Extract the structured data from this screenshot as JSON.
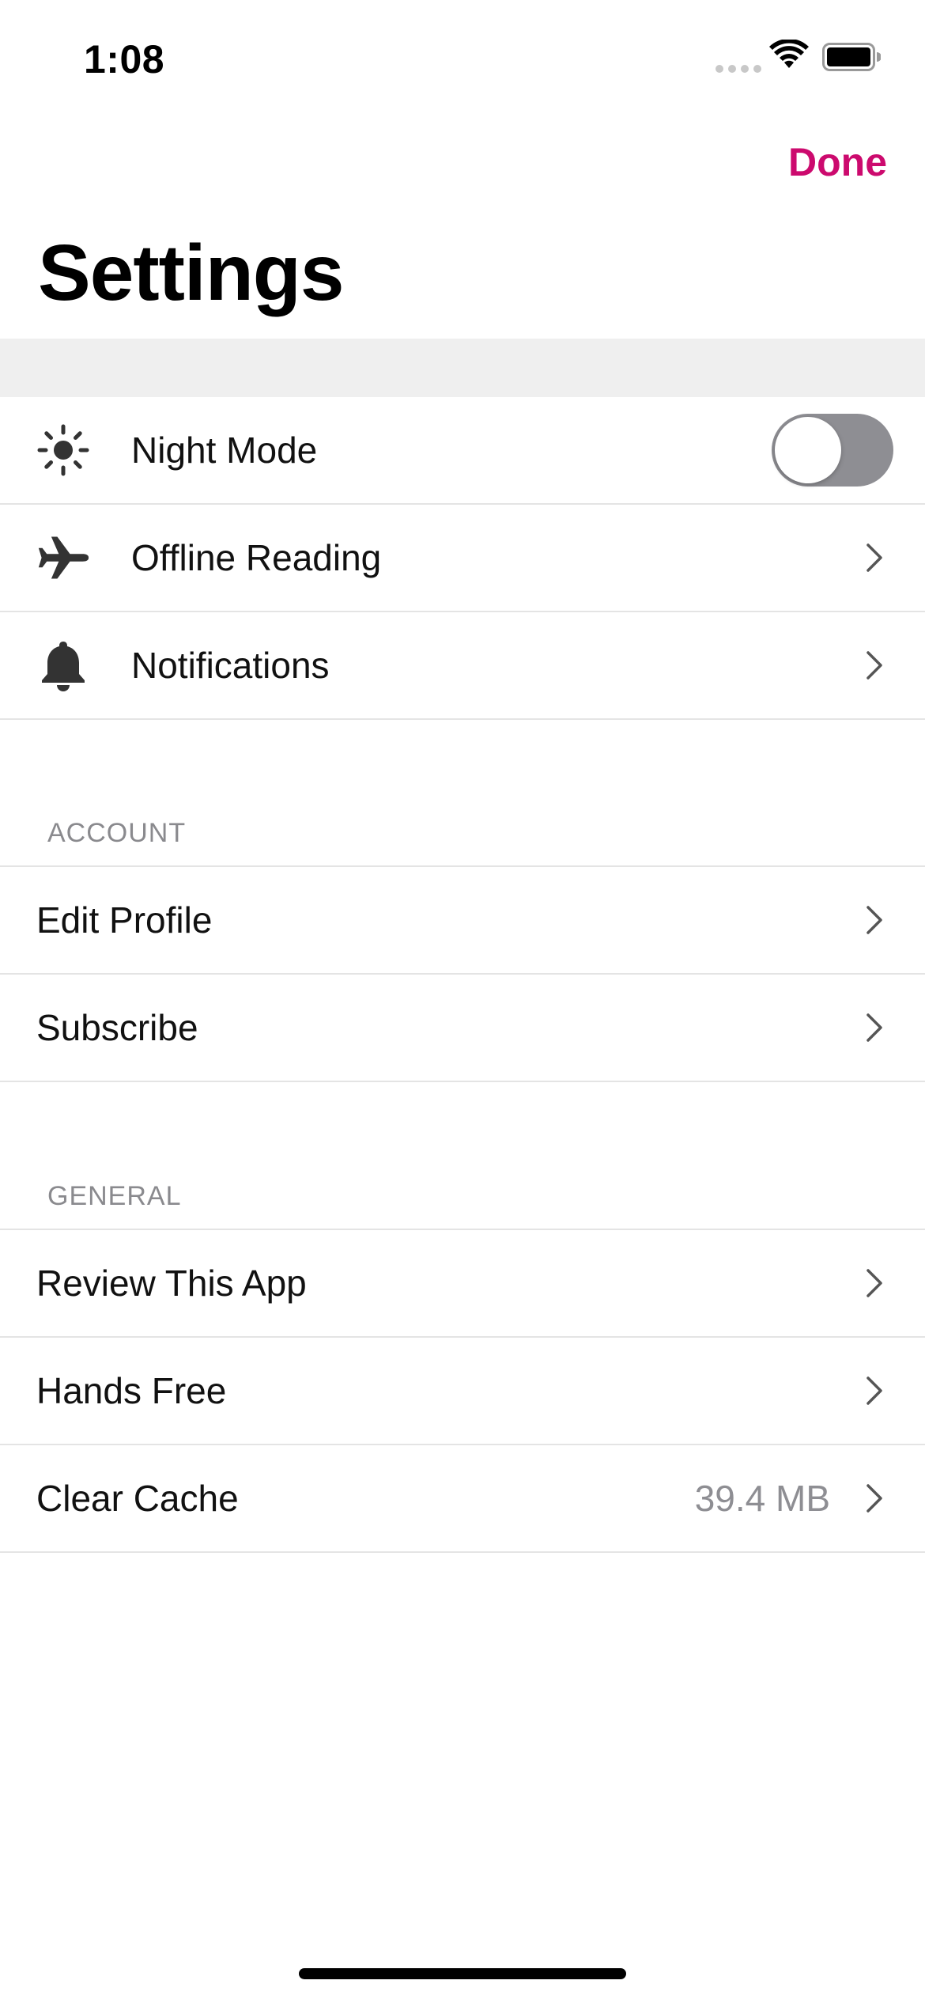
{
  "status_bar": {
    "time": "1:08",
    "icons": [
      "cellular-signal-icon",
      "wifi-icon",
      "battery-icon"
    ]
  },
  "nav": {
    "done_label": "Done",
    "title": "Settings"
  },
  "colors": {
    "accent": "#cc0a6e",
    "section_header": "#8a8a8e",
    "toggle_off": "#8e8e93",
    "band": "#efefef"
  },
  "top_section": {
    "items": [
      {
        "label": "Night Mode",
        "icon": "sun-icon",
        "control": "toggle",
        "toggle_on": false
      },
      {
        "label": "Offline Reading",
        "icon": "airplane-icon",
        "control": "chevron"
      },
      {
        "label": "Notifications",
        "icon": "bell-icon",
        "control": "chevron"
      }
    ]
  },
  "account_section": {
    "header": "ACCOUNT",
    "items": [
      {
        "label": "Edit Profile"
      },
      {
        "label": "Subscribe"
      }
    ]
  },
  "general_section": {
    "header": "GENERAL",
    "items": [
      {
        "label": "Review This App"
      },
      {
        "label": "Hands Free"
      },
      {
        "label": "Clear Cache",
        "value": "39.4 MB"
      }
    ]
  }
}
